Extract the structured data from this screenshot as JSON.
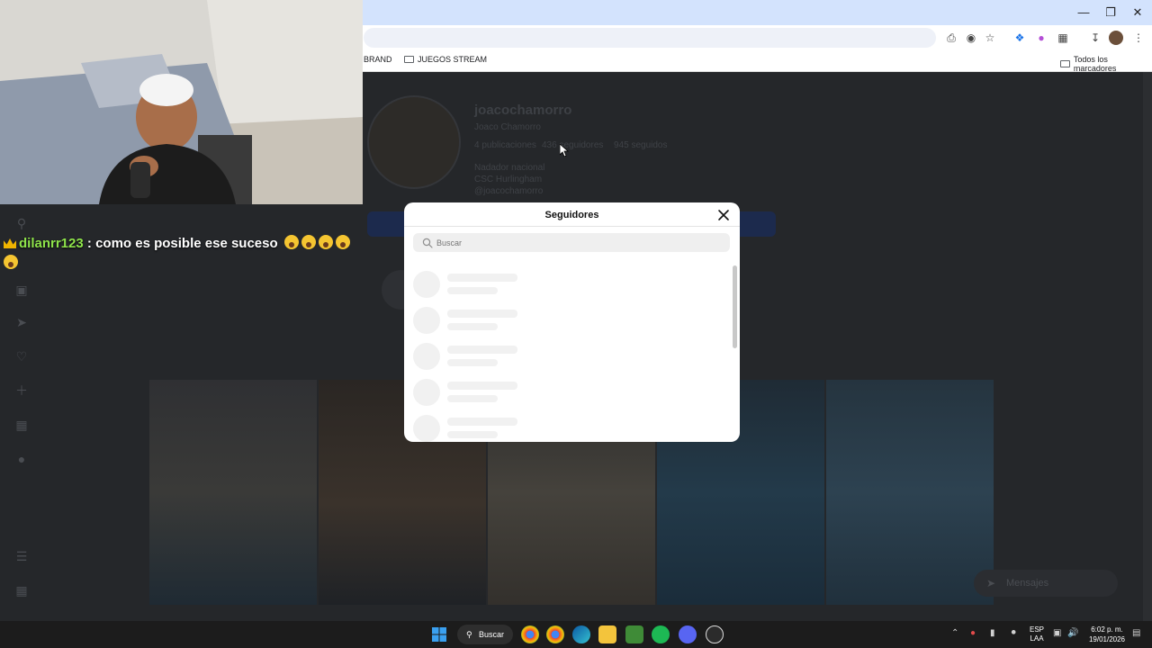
{
  "browser": {
    "bookmarks": [
      "BRAND",
      "JUEGOS STREAM"
    ],
    "all_bookmarks_label": "Todos los marcadores"
  },
  "profile": {
    "username": "joacochamorro",
    "display_name": "Joaco Chamorro",
    "posts_label": "4 publicaciones",
    "followers_label": "436 seguidores",
    "following_label": "945 seguidos",
    "bio_lines": [
      "Nadador nacional",
      "CSC Hurlingham",
      "@joacochamorro"
    ]
  },
  "chat": {
    "username": "dilanrr123",
    "separator": ":",
    "message": "como es posible ese suceso"
  },
  "modal": {
    "title": "Seguidores",
    "search_placeholder": "Buscar"
  },
  "messages_widget": {
    "label": "Mensajes"
  },
  "taskbar": {
    "search_label": "Buscar",
    "lang_line1": "ESP",
    "lang_line2": "LAA",
    "time": "6:02 p. m.",
    "date": "19/01/2026"
  },
  "colors": {
    "chat_username": "#8ee34a",
    "modal_bg": "#ffffff",
    "page_dim": "#25272a",
    "titlebar": "#d3e3fd"
  }
}
